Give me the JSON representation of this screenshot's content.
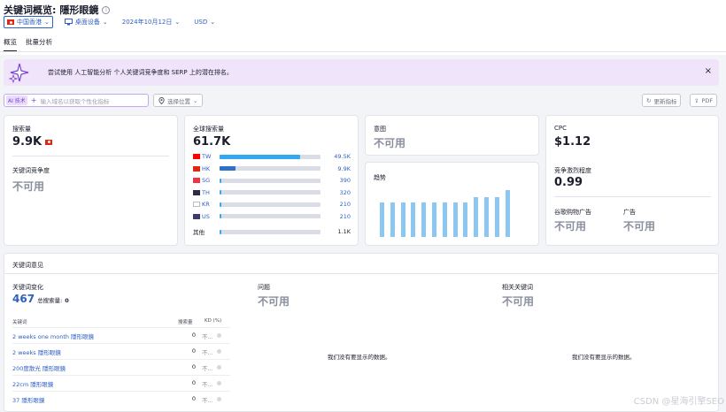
{
  "header": {
    "title_prefix": "关键词概览:",
    "keyword": "隱形眼鏡",
    "info_icon": "i",
    "filters": [
      {
        "label": "中国香港",
        "icon": "hk-flag-icon"
      },
      {
        "label": "桌面设备",
        "icon": "desktop-icon"
      },
      {
        "label": "2024年10月12日"
      },
      {
        "label": "USD"
      }
    ],
    "tabs": [
      "概览",
      "批量分析"
    ]
  },
  "banner": {
    "text": "尝试使用 人工智能分析 个人关键词竞争度和 SERP 上的潜在排名。",
    "close": "×"
  },
  "ai": {
    "badge": "AI 技术",
    "placeholder": "输入域名以获取个性化指标",
    "location": "选择位置"
  },
  "actions": {
    "refresh": "更新指标",
    "pdf": "PDF"
  },
  "volume_card": {
    "label": "搜索量",
    "value": "9.9K",
    "difficulty_label": "关键词竞争度",
    "difficulty_value": "不可用"
  },
  "global_card": {
    "label": "全球搜索量",
    "value": "61.7K",
    "rows": [
      {
        "code": "TW",
        "value": "49.5K",
        "share": 0.8,
        "color": "#35a6f0"
      },
      {
        "code": "HK",
        "value": "9.9K",
        "share": 0.16,
        "color": "#2e6fc9"
      },
      {
        "code": "SG",
        "value": "390",
        "share": 0.01,
        "color": "#35a6f0"
      },
      {
        "code": "TH",
        "value": "320",
        "share": 0.01,
        "color": "#35a6f0"
      },
      {
        "code": "KR",
        "value": "210",
        "share": 0.01,
        "color": "#35a6f0"
      },
      {
        "code": "US",
        "value": "210",
        "share": 0.01,
        "color": "#35a6f0"
      },
      {
        "code": "其他",
        "value": "1.1K",
        "share": 0.02,
        "color": "#35a6f0"
      }
    ]
  },
  "intent_card": {
    "label": "意图",
    "value": "不可用"
  },
  "trend_card": {
    "label": "趋势",
    "bars": [
      0.7,
      0.7,
      0.7,
      0.7,
      0.7,
      0.7,
      0.7,
      0.7,
      0.7,
      0.8,
      0.8,
      0.8,
      0.95
    ]
  },
  "cpc_card": {
    "cpc_label": "CPC",
    "cpc_value": "$1.12",
    "competition_label": "竞争激烈程度",
    "competition_value": "0.99",
    "shopping_label": "谷歌购物广告",
    "shopping_value": "不可用",
    "ads_label": "广告",
    "ads_value": "不可用"
  },
  "ideas": {
    "title": "关键词意见",
    "variations_label": "关键词变化",
    "variations_count": "467",
    "total_volume_label": "总搜索量:",
    "total_volume_value": "0",
    "col_keyword": "关键词",
    "col_volume": "搜索量",
    "col_kd": "KD (%)",
    "rows": [
      {
        "keyword": "2 weeks one month 隱形眼鏡",
        "volume": "0",
        "kd": "不..."
      },
      {
        "keyword": "2 weeks 隱形眼鏡",
        "volume": "0",
        "kd": "不..."
      },
      {
        "keyword": "200度散光 隱形眼鏡",
        "volume": "0",
        "kd": "不..."
      },
      {
        "keyword": "22cm 隱形眼鏡",
        "volume": "0",
        "kd": "不..."
      },
      {
        "keyword": "37 隱形眼鏡",
        "volume": "0",
        "kd": "不..."
      }
    ],
    "questions_label": "问题",
    "questions_value": "不可用",
    "questions_empty": "我们没有要显示的数据。",
    "related_label": "相关关键词",
    "related_value": "不可用",
    "related_empty": "我们没有要显示的数据。"
  },
  "watermark": "CSDN @星海引擎SEO"
}
